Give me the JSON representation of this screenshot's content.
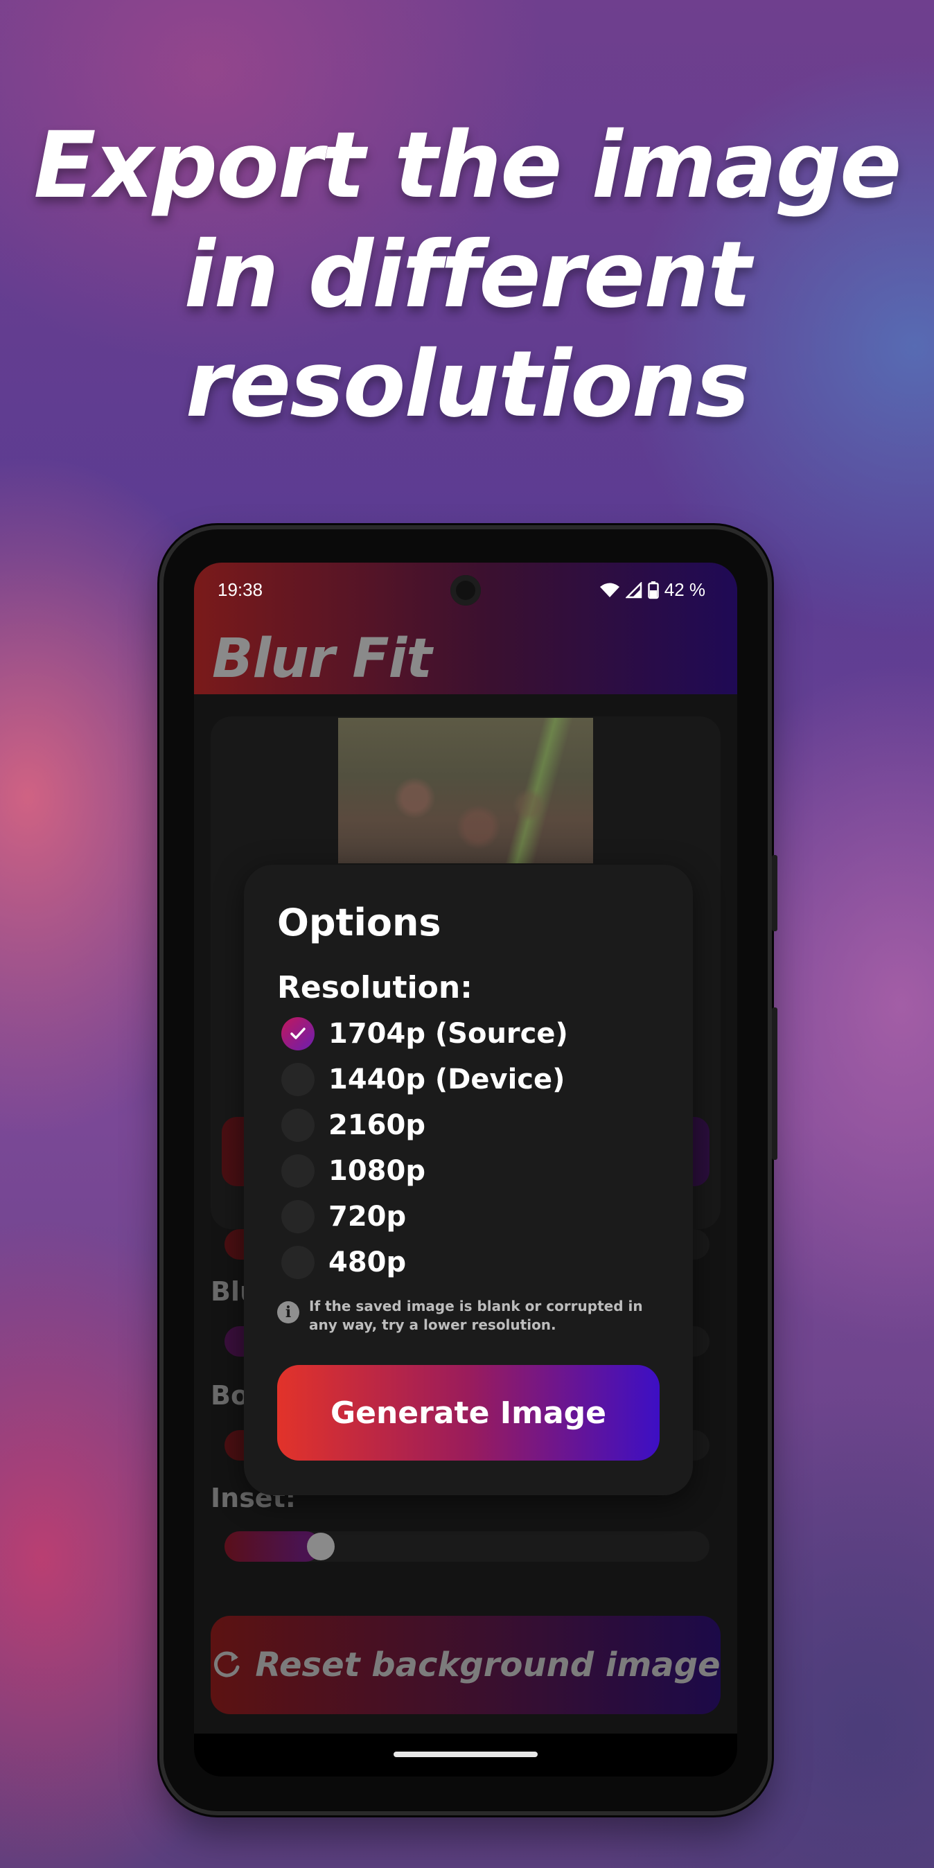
{
  "headline": [
    "Export the image",
    "in different",
    "resolutions"
  ],
  "status_bar": {
    "time": "19:38",
    "battery": "42 %"
  },
  "app": {
    "title": "Blur Fit",
    "labels": {
      "blur_partial": "Blu",
      "border_partial": "Bo",
      "inset": "Inset:"
    },
    "inset_slider_fraction": 0.17,
    "reset_button": "Reset background image"
  },
  "dialog": {
    "title": "Options",
    "resolution_label": "Resolution:",
    "options": [
      {
        "label": "1704p (Source)",
        "selected": true
      },
      {
        "label": "1440p (Device)",
        "selected": false
      },
      {
        "label": "2160p",
        "selected": false
      },
      {
        "label": "1080p",
        "selected": false
      },
      {
        "label": "720p",
        "selected": false
      },
      {
        "label": "480p",
        "selected": false
      }
    ],
    "note": "If the saved image is blank or corrupted in any way, try a lower resolution.",
    "generate_button": "Generate Image"
  },
  "colors": {
    "accent_start": "#e2332a",
    "accent_end": "#3d0fc4",
    "dialog_bg": "#1b1b1b"
  }
}
